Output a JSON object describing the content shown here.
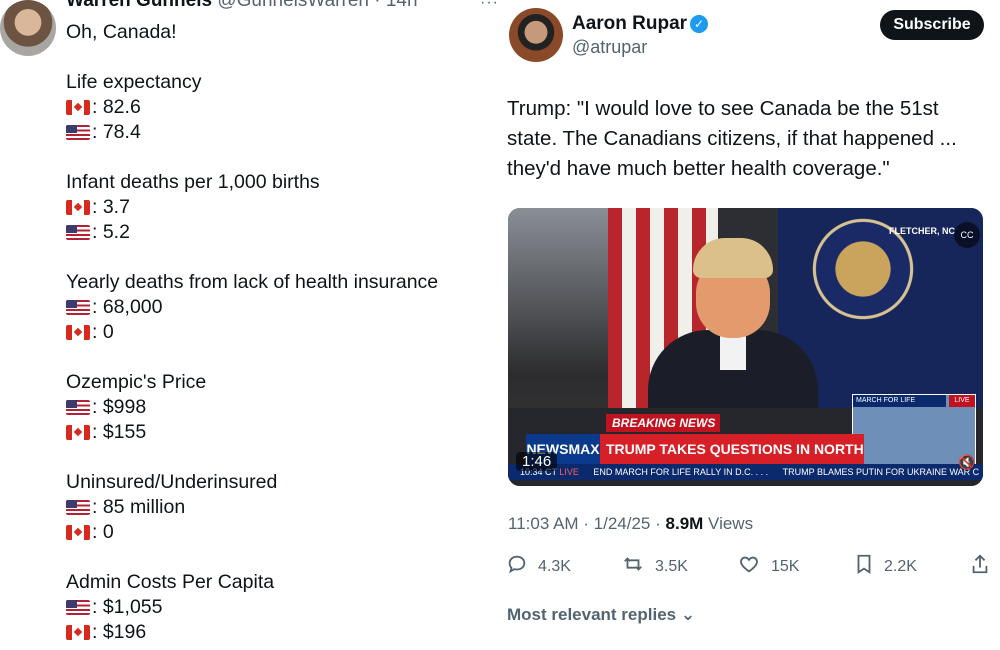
{
  "left_post": {
    "author_name": "Warren Gunnels",
    "author_handle": "@GunnelsWarren",
    "time": "· 14h",
    "more": "···",
    "intro": "Oh, Canada!",
    "sections": [
      {
        "title": "Life expectancy",
        "rows": [
          {
            "flag": "ca",
            "value": ": 82.6"
          },
          {
            "flag": "us",
            "value": ": 78.4"
          }
        ]
      },
      {
        "title": "Infant deaths per 1,000 births",
        "rows": [
          {
            "flag": "ca",
            "value": ": 3.7"
          },
          {
            "flag": "us",
            "value": ": 5.2"
          }
        ]
      },
      {
        "title": "Yearly deaths from lack of health insurance",
        "rows": [
          {
            "flag": "us",
            "value": ": 68,000"
          },
          {
            "flag": "ca",
            "value": ": 0"
          }
        ]
      },
      {
        "title": "Ozempic's Price",
        "rows": [
          {
            "flag": "us",
            "value": ": $998"
          },
          {
            "flag": "ca",
            "value": ": $155"
          }
        ]
      },
      {
        "title": "Uninsured/Underinsured",
        "rows": [
          {
            "flag": "us",
            "value": ": 85 million"
          },
          {
            "flag": "ca",
            "value": ": 0"
          }
        ]
      },
      {
        "title": "Admin Costs Per Capita",
        "rows": [
          {
            "flag": "us",
            "value": ": $1,055"
          },
          {
            "flag": "ca",
            "value": ": $196"
          }
        ]
      }
    ]
  },
  "right_post": {
    "author_name": "Aaron Rupar",
    "verified_icon": "verified-badge-icon",
    "author_handle": "@atrupar",
    "subscribe_label": "Subscribe",
    "text_lines": [
      "Trump: \"I would love to see Canada be the 51st",
      "state. The Canadians citizens, if that happened ...",
      "they'd have much better health coverage.\""
    ],
    "video": {
      "duration": "1:46",
      "location": "FLETCHER, NC",
      "cc": "CC",
      "breaking_news": "BREAKING NEWS",
      "network": "NEWSMAX",
      "headline": "TRUMP TAKES QUESTIONS IN NORTH CAROLINA",
      "ticker_time": "10:34 CT",
      "ticker_live": "LIVE",
      "ticker_items": [
        "END MARCH FOR LIFE RALLY IN D.C. . . .",
        "TRUMP BLAMES PUTIN FOR UKRAINE WAR C"
      ],
      "pip_label": "MARCH FOR LIFE",
      "pip_live": "LIVE"
    },
    "timestamp": "11:03 AM · 1/24/25 ·",
    "views_count": "8.9M",
    "views_label": "Views",
    "actions": [
      {
        "icon": "reply-icon",
        "count": "4.3K"
      },
      {
        "icon": "repost-icon",
        "count": "3.5K"
      },
      {
        "icon": "like-icon",
        "count": "15K"
      },
      {
        "icon": "bookmark-icon",
        "count": "2.2K"
      },
      {
        "icon": "share-icon",
        "count": ""
      }
    ],
    "replies_sort": "Most relevant replies",
    "replies_chevron": "chevron-down-icon"
  }
}
